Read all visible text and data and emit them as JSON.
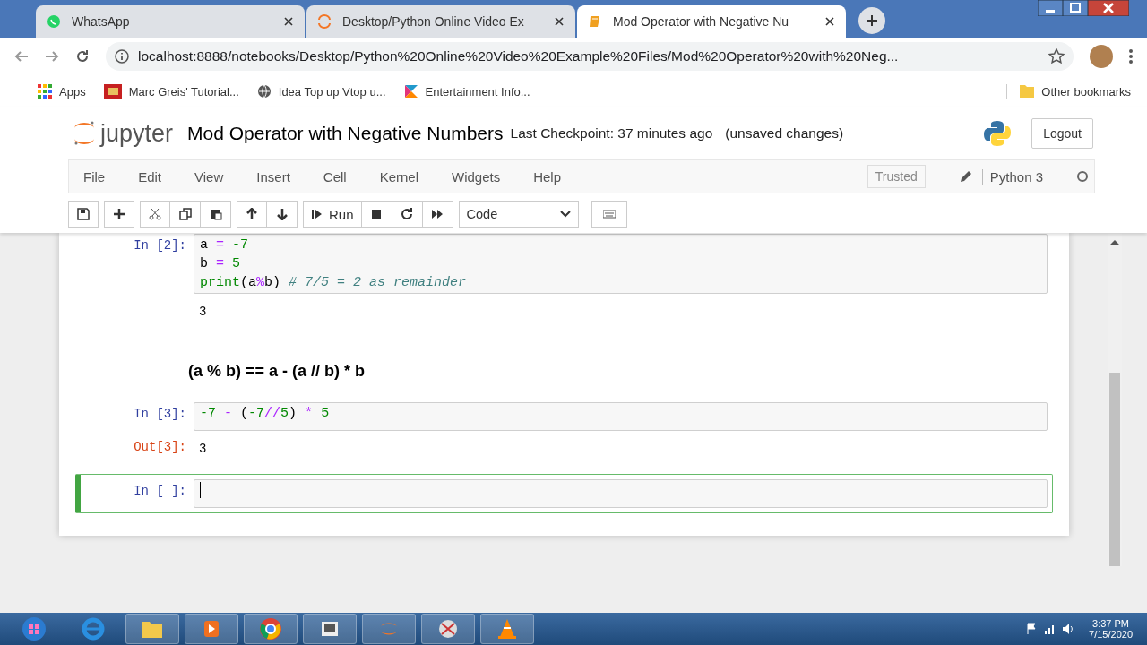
{
  "browser": {
    "tabs": [
      {
        "title": "WhatsApp",
        "kind": "whatsapp",
        "selected": false
      },
      {
        "title": "Desktop/Python Online Video Ex",
        "kind": "jupyter",
        "selected": false
      },
      {
        "title": "Mod Operator with Negative Nu",
        "kind": "notebook",
        "selected": true
      }
    ],
    "url": "localhost:8888/notebooks/Desktop/Python%20Online%20Video%20Example%20Files/Mod%20Operator%20with%20Neg...",
    "bookmarks": [
      {
        "label": "Apps",
        "kind": "apps"
      },
      {
        "label": "Marc Greis' Tutorial...",
        "kind": "isi"
      },
      {
        "label": "Idea Top up Vtop u...",
        "kind": "globe"
      },
      {
        "label": "Entertainment Info...",
        "kind": "flag"
      }
    ],
    "other_bookmarks": "Other bookmarks"
  },
  "notebook": {
    "logo": "jupyter",
    "title": "Mod Operator with Negative Numbers",
    "checkpoint": "Last Checkpoint: 37 minutes ago",
    "status": "(unsaved changes)",
    "logout": "Logout",
    "menu": [
      "File",
      "Edit",
      "View",
      "Insert",
      "Cell",
      "Kernel",
      "Widgets",
      "Help"
    ],
    "trusted": "Trusted",
    "kernel": "Python 3",
    "run": "Run",
    "cell_type": "Code",
    "cells": [
      {
        "kind": "code",
        "prompt": "In [2]:",
        "selected": false,
        "lines": [
          [
            {
              "t": "a",
              "kind": "name"
            },
            {
              "t": " = ",
              "kind": "op"
            },
            {
              "t": "-7",
              "kind": "num"
            }
          ],
          [
            {
              "t": "b",
              "kind": "name"
            },
            {
              "t": " = ",
              "kind": "op"
            },
            {
              "t": "5",
              "kind": "num"
            }
          ],
          [
            {
              "t": "print",
              "kind": "builtin"
            },
            {
              "t": "(a",
              "kind": "name"
            },
            {
              "t": "%",
              "kind": "op"
            },
            {
              "t": "b) ",
              "kind": "name"
            },
            {
              "t": "# 7/5 = 2 as remainder",
              "kind": "comment"
            }
          ]
        ],
        "output": {
          "text": "3"
        }
      },
      {
        "kind": "markdown",
        "text": "(a % b) == a - (a // b) * b"
      },
      {
        "kind": "code",
        "prompt": "In [3]:",
        "selected": false,
        "lines": [
          [
            {
              "t": "-7",
              "kind": "num"
            },
            {
              "t": " - ",
              "kind": "op"
            },
            {
              "t": "(",
              "kind": "name"
            },
            {
              "t": "-7",
              "kind": "num"
            },
            {
              "t": "//",
              "kind": "op"
            },
            {
              "t": "5",
              "kind": "num"
            },
            {
              "t": ") ",
              "kind": "name"
            },
            {
              "t": "*",
              "kind": "op"
            },
            {
              "t": " 5",
              "kind": "num"
            }
          ]
        ],
        "output": {
          "prompt": "Out[3]:",
          "text": "3"
        }
      },
      {
        "kind": "code",
        "prompt": "In [ ]:",
        "selected": true
      }
    ]
  },
  "taskbar": {
    "time": "3:37 PM",
    "date": "7/15/2020"
  }
}
